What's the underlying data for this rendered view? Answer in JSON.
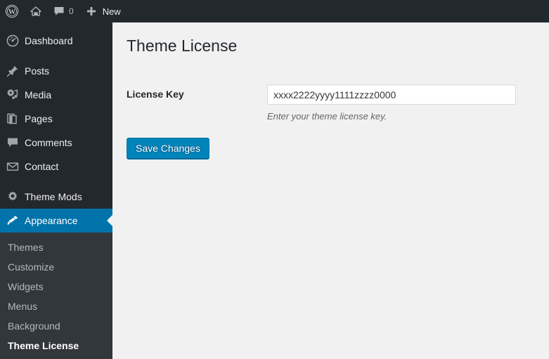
{
  "adminbar": {
    "wp_logo": "wordpress-logo",
    "site_home": "home-icon",
    "comments_icon": "comment-bubble-icon",
    "comments_count": "0",
    "new_icon": "plus-icon",
    "new_label": "New"
  },
  "sidebar": {
    "items": [
      {
        "label": "Dashboard",
        "icon": "dashboard-icon",
        "current": false
      },
      {
        "label": "Posts",
        "icon": "pin-icon",
        "current": false
      },
      {
        "label": "Media",
        "icon": "media-icon",
        "current": false
      },
      {
        "label": "Pages",
        "icon": "pages-icon",
        "current": false
      },
      {
        "label": "Comments",
        "icon": "comment-bubble-icon",
        "current": false
      },
      {
        "label": "Contact",
        "icon": "envelope-icon",
        "current": false
      },
      {
        "label": "Theme Mods",
        "icon": "gear-icon",
        "current": false
      },
      {
        "label": "Appearance",
        "icon": "paintbrush-icon",
        "current": true
      }
    ],
    "submenu": [
      {
        "label": "Themes",
        "current": false
      },
      {
        "label": "Customize",
        "current": false
      },
      {
        "label": "Widgets",
        "current": false
      },
      {
        "label": "Menus",
        "current": false
      },
      {
        "label": "Background",
        "current": false
      },
      {
        "label": "Theme License",
        "current": true
      }
    ]
  },
  "main": {
    "page_title": "Theme License",
    "fields": {
      "license_key": {
        "label": "License Key",
        "value": "xxxx2222yyyy1111zzzz0000",
        "placeholder": "",
        "description": "Enter your theme license key."
      }
    },
    "save_button": "Save Changes"
  },
  "colors": {
    "admin_bar_bg": "#23282d",
    "sidebar_bg": "#23282d",
    "submenu_bg": "#32373c",
    "highlight_blue": "#0073aa",
    "button_blue": "#0085ba",
    "content_bg": "#f1f1f1"
  }
}
